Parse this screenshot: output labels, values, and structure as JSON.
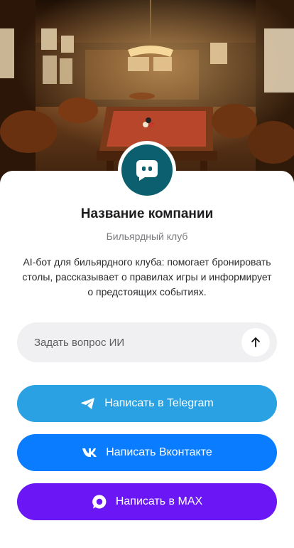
{
  "company": {
    "name": "Название компании",
    "category": "Бильярдный клуб",
    "description": "AI-бот для бильярдного клуба: помогает бронировать столы, рассказывает о правилах игры и информирует о предстоящих событиях."
  },
  "ask": {
    "placeholder": "Задать вопрос ИИ",
    "value": ""
  },
  "buttons": {
    "telegram": "Написать в Telegram",
    "vkontakte": "Написать Вконтакте",
    "max": "Написать в MAX"
  },
  "colors": {
    "avatar": "#0b5f6e",
    "telegram": "#2aa1e2",
    "vkontakte": "#0a7cff",
    "max": "#6a16f5",
    "input_bg": "#f0f0f2"
  },
  "icons": {
    "avatar": "chat-bot-icon",
    "send": "arrow-up-icon",
    "telegram": "telegram-icon",
    "vkontakte": "vk-icon",
    "max": "max-icon"
  }
}
